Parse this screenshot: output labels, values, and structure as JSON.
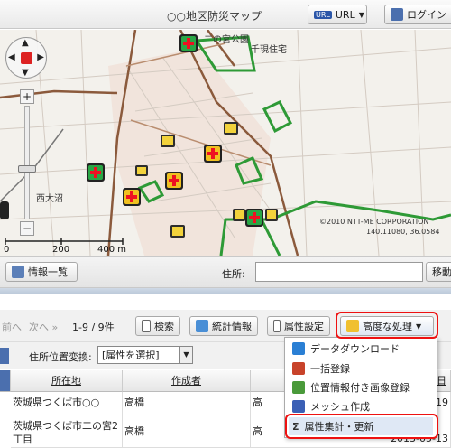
{
  "header": {
    "title": "○○地区防災マップ",
    "url_label": "URL",
    "login_label": "ログイン"
  },
  "map": {
    "place_labels": [
      "二の宮公園",
      "千現住宅",
      "西大沼"
    ],
    "copyright_line1": "©2010 NTT-ME CORPORATION",
    "copyright_line2": "140.11080, 36.0584",
    "scale_labels": [
      "0",
      "200",
      "400 m"
    ]
  },
  "toolbar1": {
    "info_list_label": "情報一覧",
    "address_label": "住所:",
    "address_value": "",
    "move_label": "移動"
  },
  "toolbar2": {
    "prev_label": "前へ",
    "next_label": "次へ »",
    "count_label": "1-9 / 9件",
    "search_label": "検索",
    "stats_label": "統計情報",
    "attr_settings_label": "属性設定",
    "advanced_label": "高度な処理"
  },
  "toolbar3": {
    "address_conv_label": "住所位置変換:",
    "attr_select_value": "[属性を選択]"
  },
  "table": {
    "headers": [
      "所在地",
      "作成者",
      "",
      "成日"
    ],
    "rows": [
      {
        "location": "茨城県つくば市○○",
        "author": "高橋",
        "author2": "高",
        "date": "19"
      },
      {
        "location": "茨城県つくば市二の宮2丁目",
        "author": "高橋",
        "author2": "高",
        "date": "2013-05-13"
      }
    ]
  },
  "menu": {
    "items": [
      {
        "label": "データダウンロード",
        "color": "#2a7fd4"
      },
      {
        "label": "一括登録",
        "color": "#c8432a"
      },
      {
        "label": "位置情報付き画像登録",
        "color": "#4a9a3a"
      },
      {
        "label": "メッシュ作成",
        "color": "#3a5fb5"
      },
      {
        "label": "属性集計・更新",
        "symbol": "Σ"
      }
    ]
  },
  "colors": {
    "highlight": "#e11111",
    "park": "#2e9a36",
    "road": "#8b5a3c"
  }
}
